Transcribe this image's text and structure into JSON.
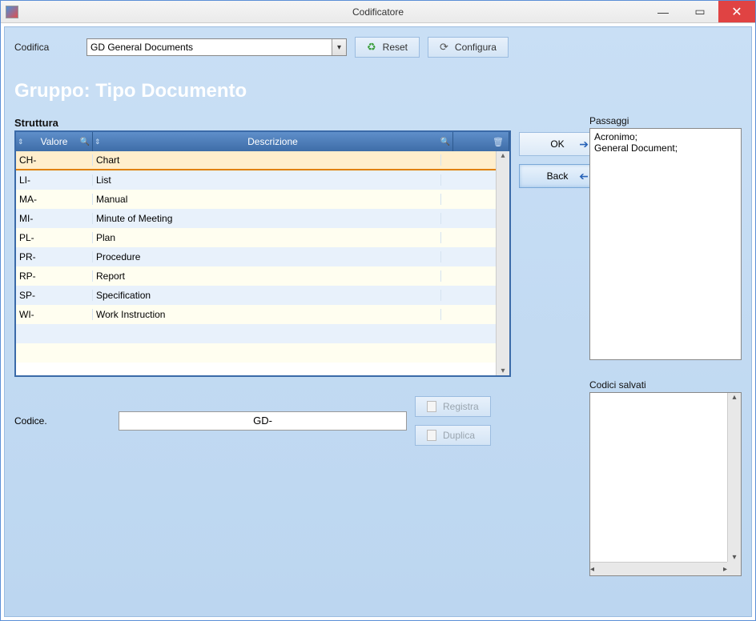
{
  "window": {
    "title": "Codificatore"
  },
  "top": {
    "codifica_label": "Codifica",
    "codifica_value": "GD General Documents",
    "reset_label": "Reset",
    "configura_label": "Configura"
  },
  "group_title": "Gruppo: Tipo Documento",
  "struttura_label": "Struttura",
  "grid": {
    "headers": {
      "valore": "Valore",
      "descrizione": "Descrizione"
    },
    "rows": [
      {
        "valore": "CH-",
        "desc": "Chart"
      },
      {
        "valore": "LI-",
        "desc": "List"
      },
      {
        "valore": "MA-",
        "desc": "Manual"
      },
      {
        "valore": "MI-",
        "desc": "Minute of Meeting"
      },
      {
        "valore": "PL-",
        "desc": "Plan"
      },
      {
        "valore": "PR-",
        "desc": "Procedure"
      },
      {
        "valore": "RP-",
        "desc": "Report"
      },
      {
        "valore": "SP-",
        "desc": "Specification"
      },
      {
        "valore": "WI-",
        "desc": "Work Instruction"
      }
    ]
  },
  "buttons": {
    "ok": "OK",
    "back": "Back",
    "registra": "Registra",
    "duplica": "Duplica"
  },
  "codice": {
    "label": "Codice.",
    "value": "GD-"
  },
  "side": {
    "passaggi_label": "Passaggi",
    "passaggi_text": "Acronimo;\nGeneral Document;",
    "codici_label": "Codici salvati"
  }
}
